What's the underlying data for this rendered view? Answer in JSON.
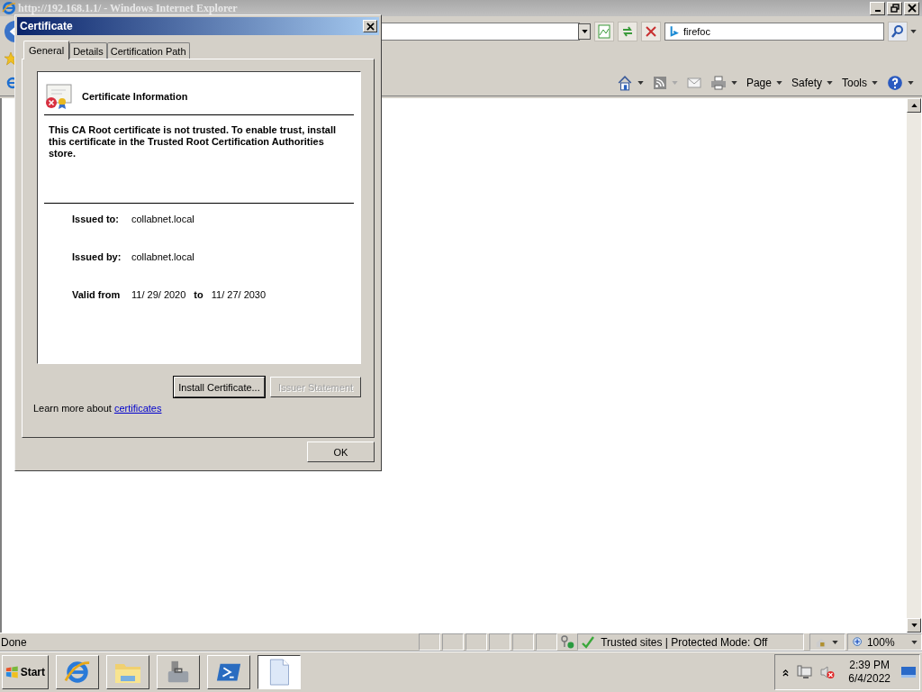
{
  "browser": {
    "title": "http://192.168.1.1/ - Windows Internet Explorer",
    "search": {
      "value": "firefoc"
    },
    "command_bar": [
      "Page",
      "Safety",
      "Tools"
    ],
    "status_bar": {
      "status": "Done",
      "zone": "Trusted sites | Protected Mode: Off",
      "zoom": "100%"
    }
  },
  "dialog": {
    "title": "Certificate",
    "tabs": [
      {
        "label": "General",
        "selected": true
      },
      {
        "label": "Details",
        "selected": false
      },
      {
        "label": "Certification Path",
        "selected": false
      }
    ],
    "heading": "Certificate Information",
    "message": "This CA Root certificate is not trusted. To enable trust, install this certificate in the Trusted Root Certification Authorities store.",
    "fields": [
      {
        "label": "Issued to:",
        "value": "collabnet.local"
      },
      {
        "label": "Issued by:",
        "value": "collabnet.local"
      }
    ],
    "validity": {
      "label": "Valid from",
      "from": "11/ 29/ 2020",
      "to_label": "to",
      "to": "11/ 27/ 2030"
    },
    "buttons": [
      {
        "label": "Install Certificate...",
        "disabled": false
      },
      {
        "label": "Issuer Statement",
        "disabled": true
      }
    ],
    "learn_more": {
      "text": "Learn more about",
      "link": "certificates"
    },
    "ok": "OK"
  },
  "taskbar": {
    "start": "Start",
    "apps": [
      {
        "kind": "browser",
        "selected": false
      },
      {
        "kind": "folder",
        "selected": false
      },
      {
        "kind": "tools",
        "selected": false
      },
      {
        "kind": "shell",
        "selected": false
      },
      {
        "kind": "document",
        "selected": true
      }
    ],
    "clock": {
      "time": "2:39 PM",
      "date": "6/4/2022"
    }
  }
}
